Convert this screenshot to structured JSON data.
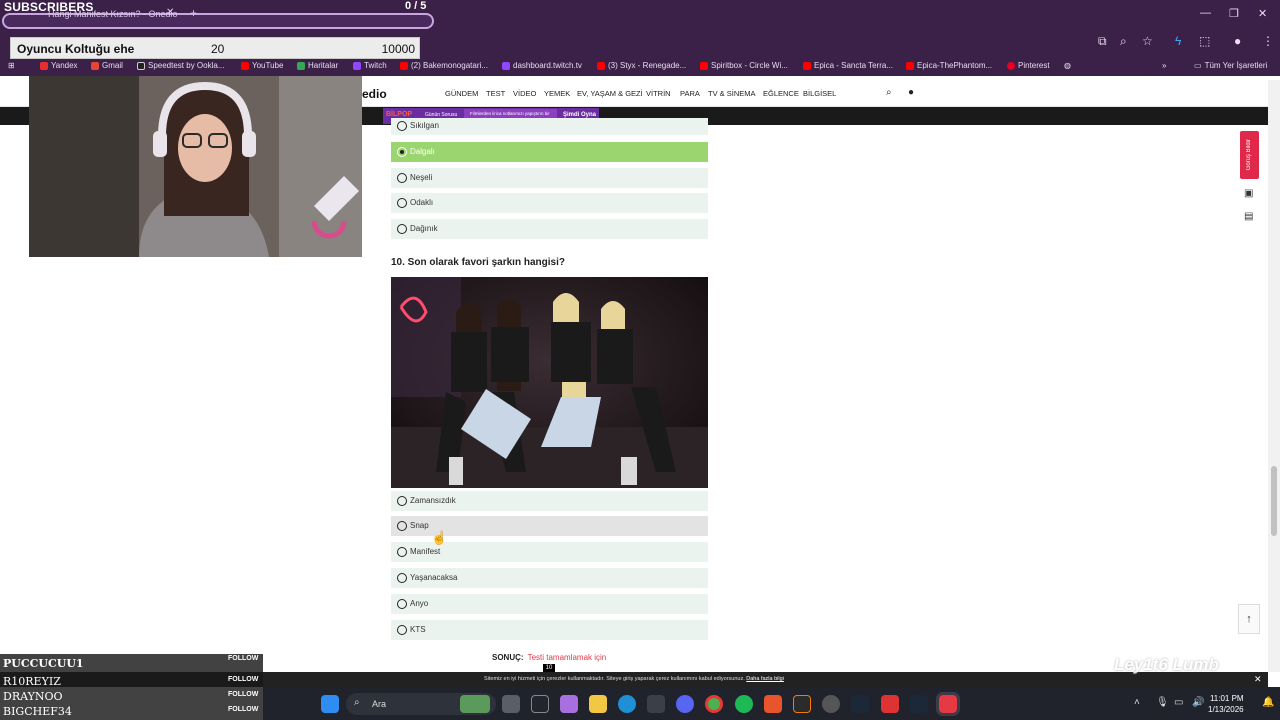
{
  "overlay": {
    "subscribers_label": "SUBSCRIBERS",
    "subscribers_count": "0 / 5",
    "goal_label": "Oyuncu Koltuğu ehe",
    "goal_current": "20",
    "goal_target": "10000"
  },
  "browser": {
    "tab_title": "Hangi Manifest Kızsın? - Onedio",
    "bookmarks": [
      "Yandex",
      "Gmail",
      "Speedtest by Ookla...",
      "YouTube",
      "Haritalar",
      "Twitch",
      "(2) Bakemonogatari...",
      "dashboard.twitch.tv",
      "(3) Styx - Renegade...",
      "Spiritbox - Circle Wi...",
      "Epica - Sancta Terra...",
      "Epica-ThePhantom...",
      "Pinterest",
      "Tüm Yer İşaretleri"
    ]
  },
  "site": {
    "logo": "edio",
    "menu": [
      "GÜNDEM",
      "TEST",
      "VİDEO",
      "YEMEK",
      "EV, YAŞAM & GEZİ",
      "VİTRİN",
      "PARA",
      "TV & SİNEMA",
      "EĞLENCE",
      "BİLGİSEL"
    ],
    "ad": {
      "brand": "BİLPOP",
      "sub": "Günün Sorusu",
      "mid_text": "Filmlerden lirica notlarımızı yapıştırın bir yer sözleşir.",
      "cta": "Şimdi Oyna"
    }
  },
  "quiz": {
    "prev_options": [
      {
        "label": "Sıkılgan",
        "selected": false
      },
      {
        "label": "Dalgalı",
        "selected": true
      },
      {
        "label": "Neşeli",
        "selected": false
      },
      {
        "label": "Odaklı",
        "selected": false
      },
      {
        "label": "Dağınık",
        "selected": false
      }
    ],
    "question": "10. Son olarak favori şarkın hangisi?",
    "options": [
      {
        "label": "Zamansızdık",
        "selected": false
      },
      {
        "label": "Snap",
        "selected": false
      },
      {
        "label": "Manifest",
        "selected": false
      },
      {
        "label": "Yaşanacaksa",
        "selected": false
      },
      {
        "label": "Anyo",
        "selected": false
      },
      {
        "label": "KTS",
        "selected": false
      }
    ],
    "result_label": "SONUÇ:",
    "result_value": "Testi tamamlamak için",
    "tooltip": "10"
  },
  "rail": {
    "side_button": "Görüş Bildir"
  },
  "cookie": {
    "text": "Sitemiz en iyi hizmeti için çerezler kullanmaktadır. Siteye giriş yaparak çerez kullanımını kabul ediyorsunuz.",
    "link": "Daha fazla bilgi"
  },
  "watermark": "Ley1t6 Lumb",
  "followers": [
    {
      "name": "PUCCUCUU1",
      "action": "FOLLOW"
    },
    {
      "name": "R10REYIZ",
      "action": "FOLLOW"
    },
    {
      "name": "DRAYNOO",
      "action": "FOLLOW"
    },
    {
      "name": "BIGCHEF34",
      "action": "FOLLOW"
    }
  ],
  "taskbar": {
    "search": "Ara",
    "time": "11:01 PM",
    "date": "1/13/2026"
  }
}
